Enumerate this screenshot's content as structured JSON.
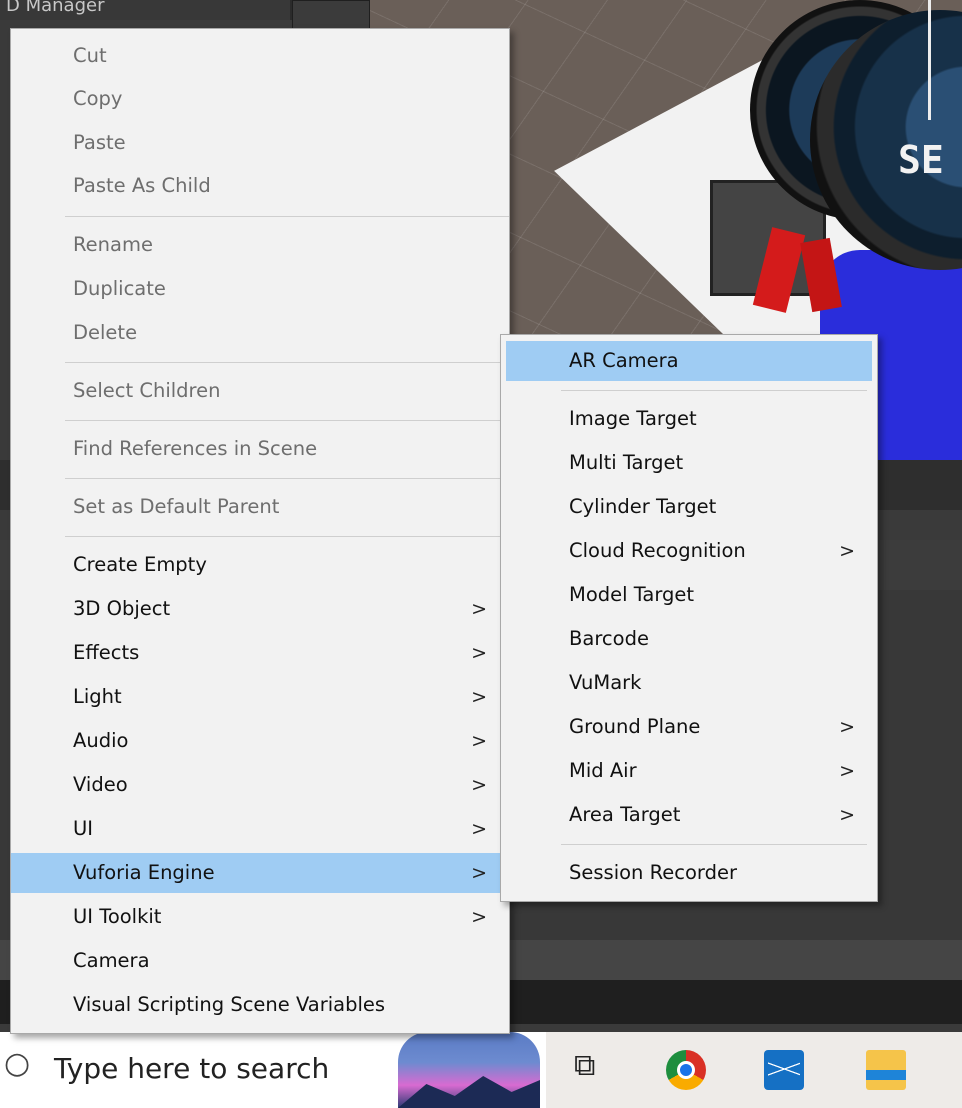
{
  "window": {
    "title_fragment": "D Manager"
  },
  "scene": {
    "watch_display_text": "SE"
  },
  "context_menu": {
    "items": [
      {
        "label": "Cut",
        "disabled": true
      },
      {
        "label": "Copy",
        "disabled": true
      },
      {
        "label": "Paste",
        "disabled": true
      },
      {
        "label": "Paste As Child",
        "disabled": true
      },
      {
        "label": "Rename",
        "disabled": true
      },
      {
        "label": "Duplicate",
        "disabled": true
      },
      {
        "label": "Delete",
        "disabled": true
      },
      {
        "label": "Select Children",
        "disabled": true
      },
      {
        "label": "Find References in Scene",
        "disabled": true
      },
      {
        "label": "Set as Default Parent",
        "disabled": true
      },
      {
        "label": "Create Empty",
        "disabled": false
      },
      {
        "label": "3D Object",
        "disabled": false,
        "submenu": true
      },
      {
        "label": "Effects",
        "disabled": false,
        "submenu": true
      },
      {
        "label": "Light",
        "disabled": false,
        "submenu": true
      },
      {
        "label": "Audio",
        "disabled": false,
        "submenu": true
      },
      {
        "label": "Video",
        "disabled": false,
        "submenu": true
      },
      {
        "label": "UI",
        "disabled": false,
        "submenu": true
      },
      {
        "label": "Vuforia Engine",
        "disabled": false,
        "submenu": true,
        "highlighted": true
      },
      {
        "label": "UI Toolkit",
        "disabled": false,
        "submenu": true
      },
      {
        "label": "Camera",
        "disabled": false
      },
      {
        "label": "Visual Scripting Scene Variables",
        "disabled": false
      }
    ]
  },
  "vuforia_submenu": {
    "items": [
      {
        "label": "AR Camera",
        "highlighted": true
      },
      {
        "label": "Image Target"
      },
      {
        "label": "Multi Target"
      },
      {
        "label": "Cylinder Target"
      },
      {
        "label": "Cloud Recognition",
        "submenu": true
      },
      {
        "label": "Model Target"
      },
      {
        "label": "Barcode"
      },
      {
        "label": "VuMark"
      },
      {
        "label": "Ground Plane",
        "submenu": true
      },
      {
        "label": "Mid Air",
        "submenu": true
      },
      {
        "label": "Area Target",
        "submenu": true
      },
      {
        "label": "Session Recorder"
      }
    ]
  },
  "submenu_arrow": ">",
  "taskbar": {
    "search_placeholder": "Type here to search",
    "search_icon_glyph": "○",
    "task_view_glyph": "⧉",
    "icons": [
      "search-icon",
      "task-view-icon",
      "chrome-icon",
      "mail-icon",
      "file-explorer-icon"
    ]
  },
  "colors": {
    "menu_bg": "#f2f2f2",
    "highlight": "#9fccf3",
    "disabled_text": "#6e6e6e",
    "taskbar_bg": "#eeebe8"
  }
}
